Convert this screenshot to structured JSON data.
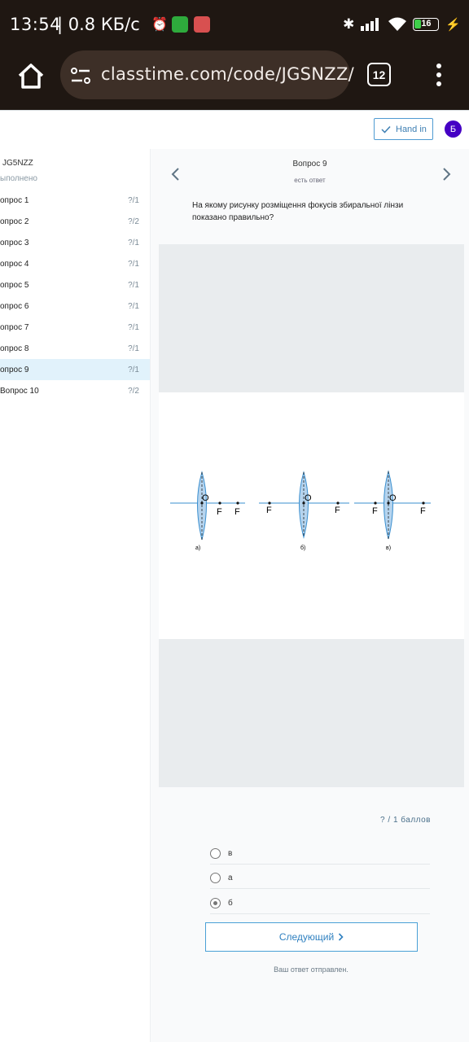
{
  "status_bar": {
    "time": "13:54",
    "net": "| 0.8 КБ/с",
    "battery": "16"
  },
  "browser": {
    "url": "classtime.com/code/JGSNZZ/",
    "tab_count": "12"
  },
  "header": {
    "hand_in_label": "Hand in",
    "avatar_letter": "Б"
  },
  "sidebar": {
    "code": "JG5NZZ",
    "status": "ыполнено",
    "items": [
      {
        "label": "опрос 1",
        "score": "?/1"
      },
      {
        "label": "опрос 2",
        "score": "?/2"
      },
      {
        "label": "опрос 3",
        "score": "?/1"
      },
      {
        "label": "опрос 4",
        "score": "?/1"
      },
      {
        "label": "опрос 5",
        "score": "?/1"
      },
      {
        "label": "опрос 6",
        "score": "?/1"
      },
      {
        "label": "опрос 7",
        "score": "?/1"
      },
      {
        "label": "опрос 8",
        "score": "?/1"
      },
      {
        "label": "опрос 9",
        "score": "?/1"
      },
      {
        "label": "Вопрос 10",
        "score": "?/2"
      }
    ],
    "active_index": 8
  },
  "question": {
    "title": "Вопрос 9",
    "subtitle": "есть ответ",
    "text": "На якому рисунку розміщення фокусів збиральної лінзи показано правильно?",
    "figure": {
      "point_o": "O",
      "focus": "F",
      "labels": [
        "а)",
        "б)",
        "в)"
      ]
    },
    "score": "? / 1 баллов",
    "options": [
      {
        "label": "в",
        "selected": false
      },
      {
        "label": "а",
        "selected": false
      },
      {
        "label": "б",
        "selected": true
      }
    ],
    "next_label": "Следующий",
    "sent_message": "Ваш ответ отправлен."
  },
  "colors": {
    "status_bg": "#1f1712",
    "accent": "#2f80c0",
    "avatar": "#4500c4",
    "active_row": "#e1f2fb"
  }
}
